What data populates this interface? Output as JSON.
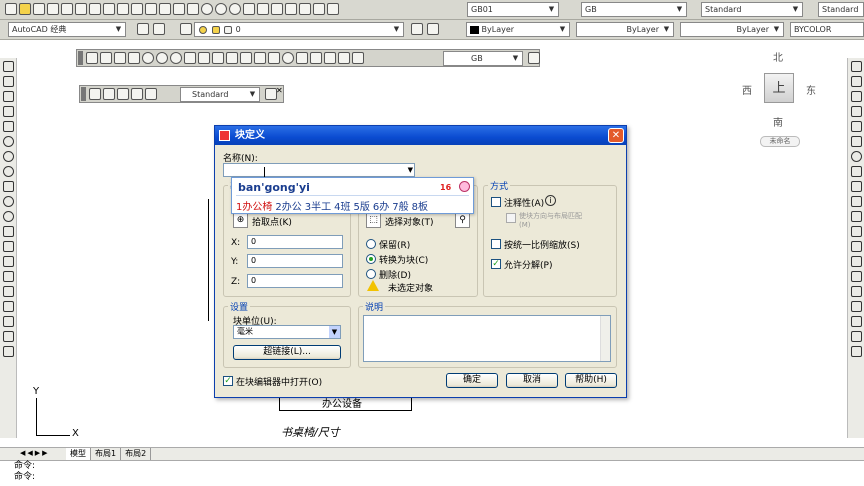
{
  "toolbar_top": {
    "workspace": "AutoCAD 经典",
    "layer": "0",
    "dimstyle": "GB01",
    "textstyle": "GB",
    "tablestyle": "Standard",
    "mlstyle": "Standard",
    "color": "ByLayer",
    "linetype": "ByLayer",
    "lineweight": "ByLayer",
    "plotstyle": "BYCOLOR"
  },
  "dim_toolbar": {
    "style": "GB"
  },
  "mleader_toolbar": {
    "style": "Standard"
  },
  "viewcube": {
    "north": "北",
    "south": "南",
    "east": "东",
    "west": "西",
    "top": "上",
    "wcs": "未命名"
  },
  "drawing": {
    "text1": "办公设备",
    "text2": "书桌椅/尺寸"
  },
  "ucs": {
    "x": "X",
    "y": "Y"
  },
  "tabs": [
    "模型",
    "布局1",
    "布局2"
  ],
  "command_lines": [
    "命令:",
    "命令:"
  ],
  "dialog": {
    "title": "块定义",
    "name_label": "名称(N):",
    "name_value": "",
    "base_group_title": "基点",
    "pick_point_label": "拾取点(K)",
    "x_label": "X:",
    "x_value": "0",
    "y_label": "Y:",
    "y_value": "0",
    "z_label": "Z:",
    "z_value": "0",
    "objects_group_title": "对象",
    "select_objects_label": "选择对象(T)",
    "retain_label": "保留(R)",
    "convert_label": "转换为块(C)",
    "delete_label": "删除(D)",
    "none_selected": "未选定对象",
    "behavior_group_title": "方式",
    "annotative_label": "注释性(A)",
    "match_orient_label": "使块方向与布局匹配(M)",
    "scale_uniform_label": "按统一比例缩放(S)",
    "allow_explode_label": "允许分解(P)",
    "settings_group_title": "设置",
    "unit_label": "块单位(U):",
    "unit_value": "毫米",
    "hyperlink_label": "超链接(L)...",
    "desc_group_title": "说明",
    "open_editor_label": "在块编辑器中打开(O)",
    "ok_label": "确定",
    "cancel_label": "取消",
    "help_label": "帮助(H)",
    "close_glyph": "✕"
  },
  "ime": {
    "pinyin": "ban'gong'yi",
    "count": "16",
    "candidates": [
      "1办公椅",
      "2办公",
      "3半工",
      "4班",
      "5版",
      "6办",
      "7般",
      "8板"
    ]
  }
}
